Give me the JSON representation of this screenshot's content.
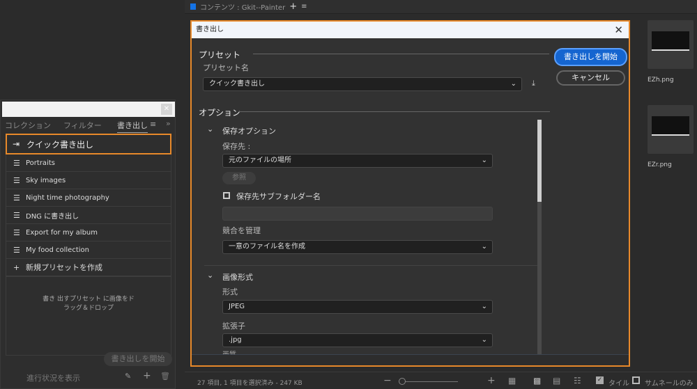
{
  "left_panel": {
    "tabs": [
      "コレクション",
      "フィルター",
      "書き出し"
    ],
    "quick_export": "クイック書き出し",
    "presets": [
      "Portraits",
      "Sky images",
      "Night time photography",
      "DNG に書き出し",
      "Export for my album",
      "My food collection"
    ],
    "new_preset": "新規プリセットを作成",
    "drop_hint_line1": "書き 出すプリセット に画像をド",
    "drop_hint_line2": "ラッグ＆ドロップ",
    "export_button": "書き出しを開始",
    "show_progress": "進行状況を表示"
  },
  "content_header": {
    "title": "コンテンツ : Gkit--Painter",
    "accent": "#1473e6"
  },
  "thumbnails": [
    {
      "name": "EZh.png"
    },
    {
      "name": "EZr.png"
    }
  ],
  "dialog": {
    "title": "書き出し",
    "preset_section": "プリセット",
    "preset_name_label": "プリセット名",
    "preset_value": "クイック書き出し",
    "start_button": "書き出しを開始",
    "cancel_button": "キャンセル",
    "options_section": "オプション",
    "save_options": {
      "title": "保存オプション",
      "dest_label": "保存先 :",
      "dest_value": "元のファイルの場所",
      "browse": "参照",
      "subfolder_label": "保存先サブフォルダー名",
      "subfolder_value": "",
      "conflict_label": "競合を管理",
      "conflict_value": "一意のファイル名を作成"
    },
    "image_format": {
      "title": "画像形式",
      "format_label": "形式",
      "format_value": "JPEG",
      "ext_label": "拡張子",
      "ext_value": ".jpg",
      "quality_label": "画質"
    }
  },
  "status_bar": {
    "summary": "27 項目, 1 項目を選択済み - 247 KB",
    "tile_label": "タイル",
    "thumb_only_label": "サムネールのみ",
    "tile_checked": true,
    "thumb_only_checked": false
  }
}
